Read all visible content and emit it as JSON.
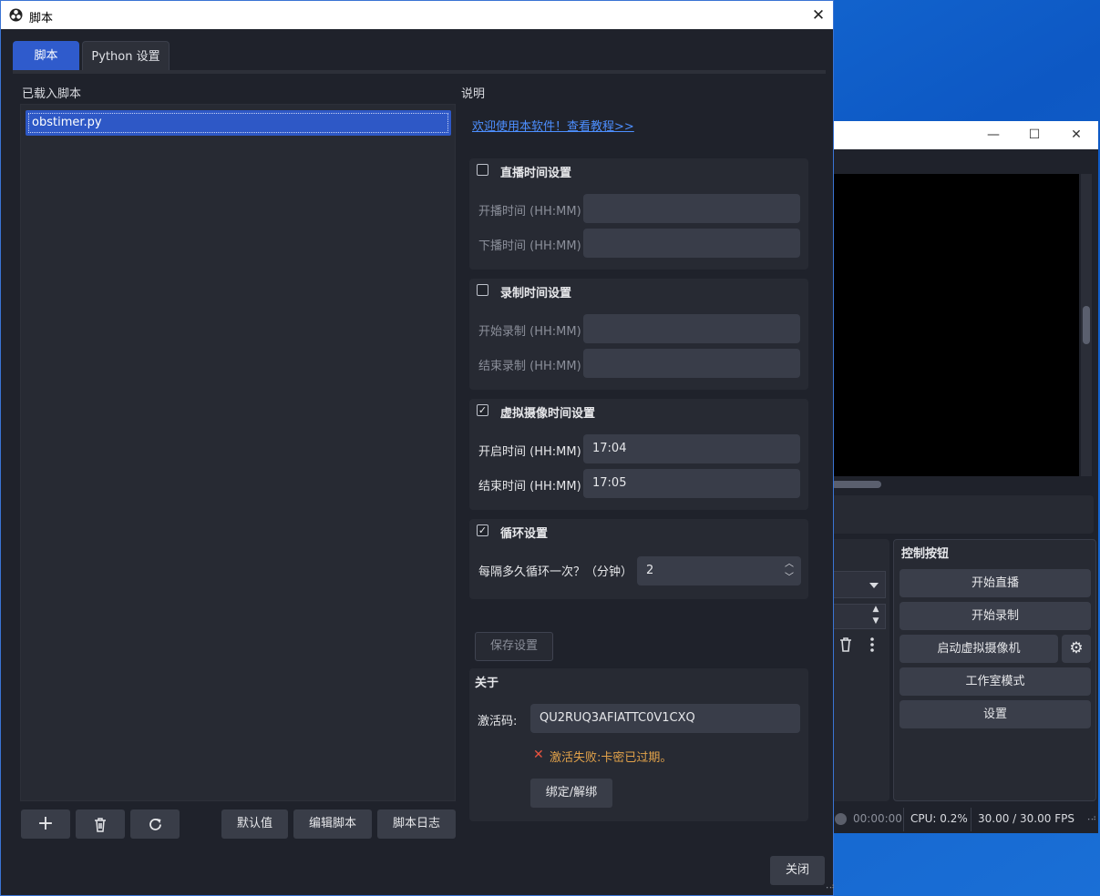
{
  "dialog": {
    "title": "脚本",
    "tabs": [
      {
        "label": "脚本",
        "active": true
      },
      {
        "label": "Python 设置",
        "active": false
      }
    ],
    "loaded_scripts_label": "已载入脚本",
    "scripts": [
      "obstimer.py"
    ],
    "toolbar": {
      "add_icon": "+",
      "remove_icon": "trash-icon",
      "reload_icon": "reload-icon",
      "defaults_label": "默认值",
      "edit_label": "编辑脚本",
      "log_label": "脚本日志"
    },
    "description_label": "说明",
    "tutorial_link": "欢迎使用本软件！查看教程>>",
    "groups": {
      "live": {
        "title": "直播时间设置",
        "checked": false,
        "start_label": "开播时间 (HH:MM)",
        "start_value": "",
        "end_label": "下播时间 (HH:MM)",
        "end_value": ""
      },
      "record": {
        "title": "录制时间设置",
        "checked": false,
        "start_label": "开始录制 (HH:MM)",
        "start_value": "",
        "end_label": "结束录制 (HH:MM)",
        "end_value": ""
      },
      "vcam": {
        "title": "虚拟摄像时间设置",
        "checked": true,
        "start_label": "开启时间 (HH:MM)",
        "start_value": "17:04",
        "end_label": "结束时间 (HH:MM)",
        "end_value": "17:05"
      },
      "loop": {
        "title": "循环设置",
        "checked": true,
        "interval_label": "每隔多久循环一次？（分钟）",
        "interval_value": "2"
      }
    },
    "save_label": "保存设置",
    "about": {
      "title": "关于",
      "code_label": "激活码:",
      "code_value": "QU2RUQ3AFIATTC0V1CXQ",
      "error_text": "激活失败:卡密已过期。",
      "bind_label": "绑定/解绑"
    },
    "close_label": "关闭"
  },
  "obs": {
    "controls_title": "控制按钮",
    "buttons": [
      "开始直播",
      "开始录制",
      "启动虚拟摄像机",
      "工作室模式",
      "设置"
    ],
    "status": {
      "time": "00:00:00",
      "cpu": "CPU: 0.2%",
      "fps": "30.00 / 30.00 FPS"
    }
  },
  "colors": {
    "accent": "#2f5bcc",
    "panel": "#272a33",
    "background": "#1f222b",
    "link": "#4d8fff",
    "error": "#e8533f",
    "warning_text": "#e2a24a"
  }
}
